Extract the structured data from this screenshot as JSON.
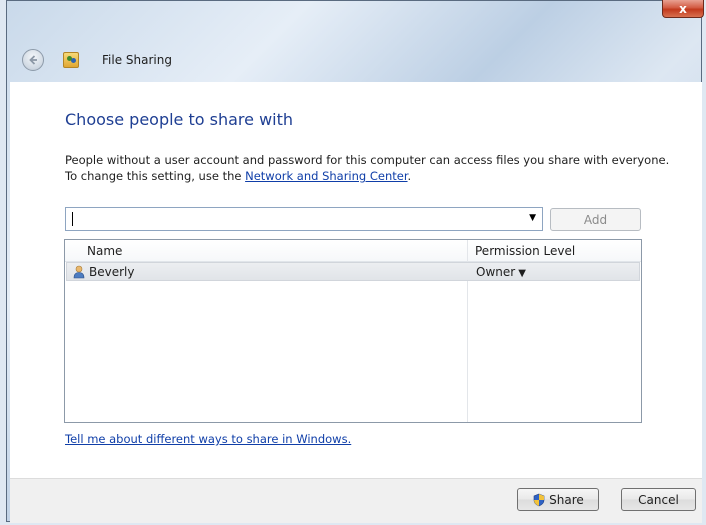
{
  "window": {
    "title": "File Sharing",
    "close_label": "x"
  },
  "main": {
    "heading": "Choose people to share with",
    "description_line1": "People without a user account and password for this computer can access files you share with everyone.",
    "description_line2_prefix": "To change this setting, use the ",
    "description_link": "Network and Sharing Center",
    "description_line2_suffix": ".",
    "name_input": {
      "value": "",
      "placeholder": ""
    },
    "add_button": "Add",
    "list": {
      "columns": [
        "Name",
        "Permission Level"
      ],
      "rows": [
        {
          "name": "Beverly",
          "permission": "Owner"
        }
      ]
    },
    "help_link": "Tell me about different ways to share in Windows."
  },
  "footer": {
    "share_button": "Share",
    "cancel_button": "Cancel"
  },
  "icons": {
    "back": "back-arrow-icon",
    "app": "file-sharing-icon",
    "user": "user-icon",
    "shield": "uac-shield-icon"
  }
}
